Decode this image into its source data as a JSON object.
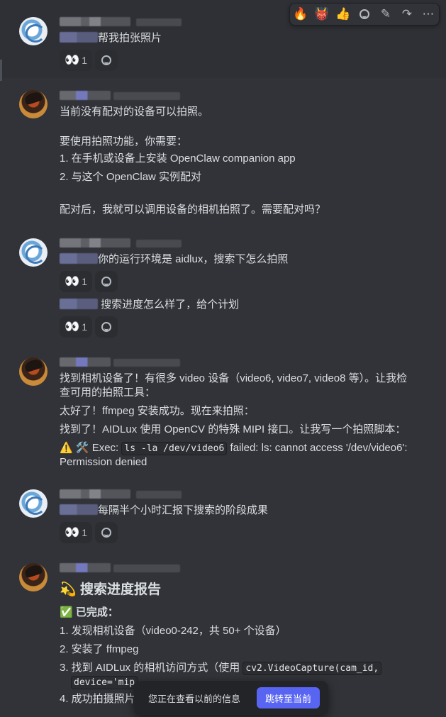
{
  "toolbar": {
    "reactions": [
      "🔥",
      "👹",
      "👍"
    ],
    "add_reaction_icon": "smile-plus-icon",
    "edit_icon": "pencil-icon",
    "forward_icon": "forward-arrow-icon",
    "more_icon": "ellipsis-icon",
    "edit_glyph": "✎",
    "forward_glyph": "↷",
    "more_glyph": "⋯"
  },
  "messages": [
    {
      "id": "m1",
      "lines": [
        "帮我拍张照片"
      ],
      "reaction": {
        "emoji": "👀",
        "count": "1"
      }
    },
    {
      "id": "m2",
      "lines": [
        "当前没有配对的设备可以拍照。",
        "",
        "要使用拍照功能，你需要：",
        "1. 在手机或设备上安装 OpenClaw companion app",
        "2. 与这个 OpenClaw 实例配对",
        "",
        "配对后，我就可以调用设备的相机拍照了。需要配对吗？"
      ]
    },
    {
      "id": "m3",
      "lines": [
        "你的运行环境是 aidlux，搜索下怎么拍照"
      ],
      "reaction": {
        "emoji": "👀",
        "count": "1"
      }
    },
    {
      "id": "m3b",
      "lines": [
        "搜索进度怎么样了，给个计划"
      ],
      "reaction": {
        "emoji": "👀",
        "count": "1"
      }
    },
    {
      "id": "m4",
      "lines": [
        "找到相机设备了！有很多 video 设备（video6, video7, video8 等）。让我检",
        "查可用的拍照工具：",
        "太好了！ffmpeg 安装成功。现在来拍照：",
        "找到了！AIDLux 使用 OpenCV 的特殊 MIPI 接口。让我写一个拍照脚本："
      ],
      "exec": {
        "icons": "⚠️ 🛠️",
        "prefix": "Exec: ",
        "code": "ls -la /dev/video6",
        "suffix": " failed: ls: cannot access '/dev/video6':",
        "line2": "Permission denied"
      }
    },
    {
      "id": "m5",
      "lines": [
        "每隔半个小时汇报下搜索的阶段成果"
      ],
      "reaction": {
        "emoji": "👀",
        "count": "1"
      }
    },
    {
      "id": "m6",
      "heading_icon": "💫",
      "heading": "搜索进度报告",
      "subhead_icon": "✅",
      "subhead": "已完成：",
      "items": [
        "1. 发现相机设备（video0-242，共 50+ 个设备）",
        "2. 安装了 ffmpeg"
      ],
      "item3_prefix": "3. 找到 AIDLux 的相机访问方式（使用 ",
      "item3_code": "cv2.VideoCapture(cam_id,",
      "item3_code2": "device='mip",
      "item4": "4. 成功拍摄照片"
    }
  ],
  "jump_bar": {
    "text": "您正在查看以前的信息",
    "button": "跳转至当前"
  }
}
